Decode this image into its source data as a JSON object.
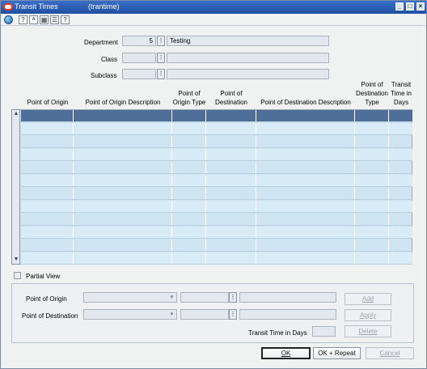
{
  "window": {
    "title": "Transit Times",
    "subtitle": "(trantime)",
    "buttons": [
      "_",
      "□",
      "×"
    ]
  },
  "toolbar": {
    "items": [
      {
        "name": "globe-icon",
        "glyph": ""
      },
      {
        "name": "help-icon",
        "glyph": "?"
      },
      {
        "name": "spellcheck-icon",
        "glyph": "ᴬ"
      },
      {
        "name": "document-icon",
        "glyph": "▦"
      },
      {
        "name": "list-icon",
        "glyph": "☰"
      },
      {
        "name": "question-icon",
        "glyph": "?"
      }
    ]
  },
  "filters": {
    "department": {
      "label": "Department",
      "value": "5",
      "description": "Testing"
    },
    "class": {
      "label": "Class",
      "value": "",
      "description": ""
    },
    "subclass": {
      "label": "Subclass",
      "value": "",
      "description": ""
    },
    "lov_glyph": "⋮"
  },
  "grid": {
    "columns": [
      "Point of Origin",
      "Point of Origin Description",
      "Point of Origin Type",
      "Point of Destination",
      "Point of Destination Description",
      "Point of Destination Type",
      "Transit Time in Days"
    ],
    "row_count": 12,
    "selected_row": 0,
    "scroll_up": "▲",
    "scroll_down": "▼"
  },
  "partial_view": {
    "label": "Partial View",
    "checked": false
  },
  "detail": {
    "origin_label": "Point of Origin",
    "destination_label": "Point of Destination",
    "transit_label": "Transit Time in Days",
    "dropdown_arrow": "▾",
    "lov_glyph": "⋮"
  },
  "actions": {
    "add": "Add",
    "apply": "Apply",
    "delete": "Delete",
    "ok": "OK",
    "ok_repeat": "OK + Repeat",
    "cancel": "Cancel"
  }
}
